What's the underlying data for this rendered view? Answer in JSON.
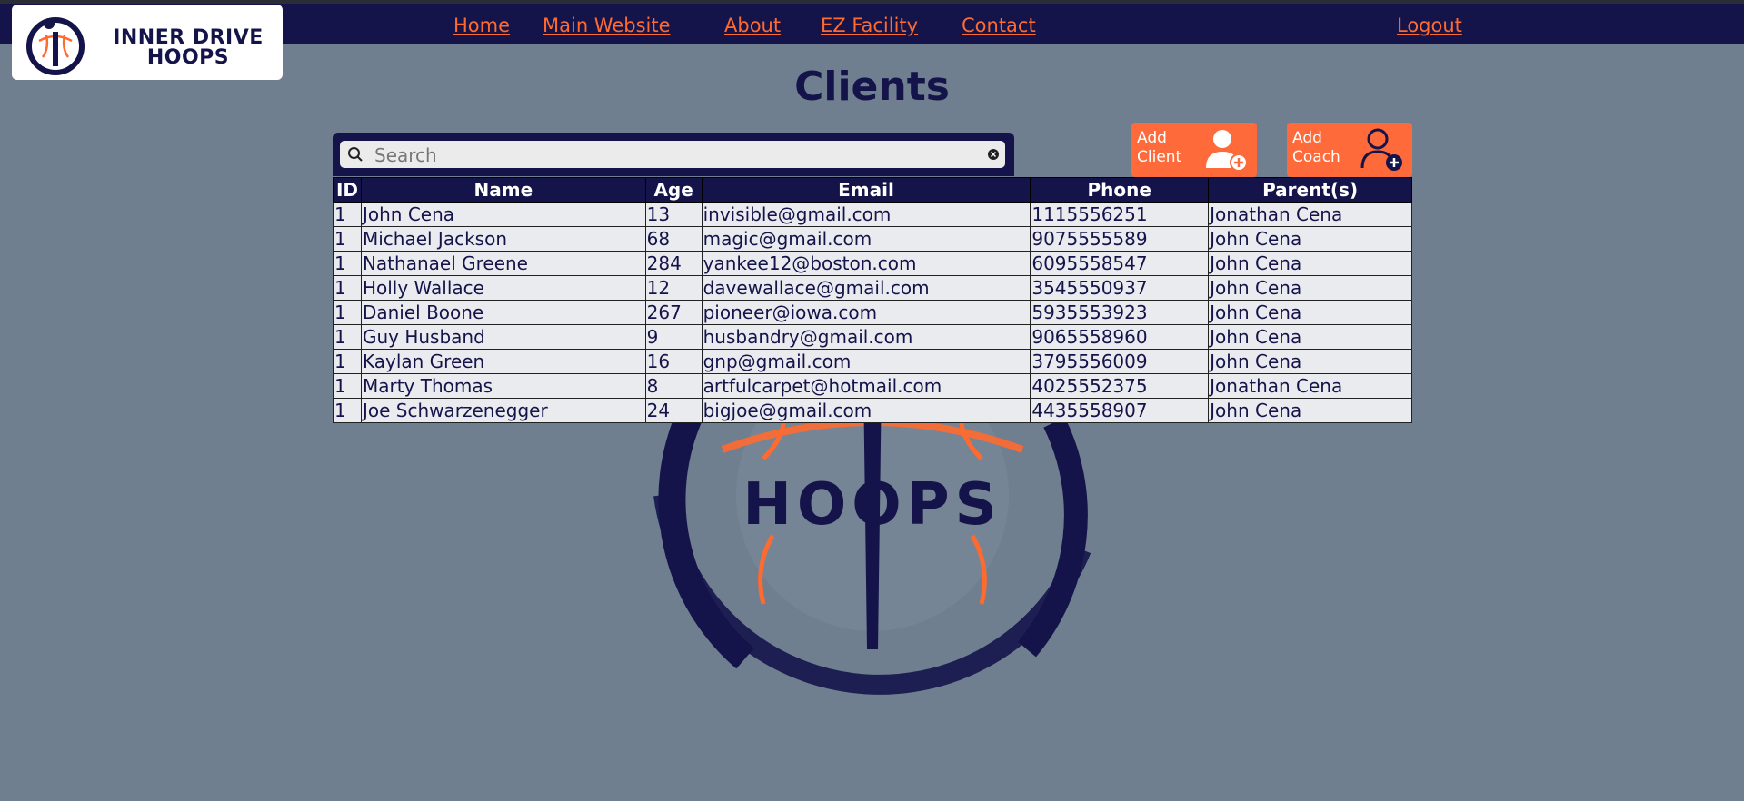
{
  "brand": {
    "line1": "INNER DRIVE",
    "line2": "HOOPS"
  },
  "nav": {
    "home": "Home",
    "main_website": "Main Website",
    "about": "About",
    "ez_facility": "EZ Facility",
    "contact": "Contact",
    "logout": "Logout"
  },
  "page": {
    "title": "Clients"
  },
  "search": {
    "placeholder": "Search",
    "value": ""
  },
  "actions": {
    "add_client_line1": "Add",
    "add_client_line2": "Client",
    "add_coach_line1": "Add",
    "add_coach_line2": "Coach"
  },
  "watermark_text": "HOOPS",
  "table": {
    "headers": [
      "ID",
      "Name",
      "Age",
      "Email",
      "Phone",
      "Parent(s)"
    ],
    "rows": [
      [
        "1",
        "John Cena",
        "13",
        "invisible@gmail.com",
        "1115556251",
        "Jonathan Cena"
      ],
      [
        "1",
        "Michael Jackson",
        "68",
        "magic@gmail.com",
        "9075555589",
        "John Cena"
      ],
      [
        "1",
        "Nathanael Greene",
        "284",
        "yankee12@boston.com",
        "6095558547",
        "John Cena"
      ],
      [
        "1",
        "Holly Wallace",
        "12",
        "davewallace@gmail.com",
        "3545550937",
        "John Cena"
      ],
      [
        "1",
        "Daniel Boone",
        "267",
        "pioneer@iowa.com",
        "5935553923",
        "John Cena"
      ],
      [
        "1",
        "Guy Husband",
        "9",
        "husbandry@gmail.com",
        "9065558960",
        "John Cena"
      ],
      [
        "1",
        "Kaylan Green",
        "16",
        "gnp@gmail.com",
        "3795556009",
        "John Cena"
      ],
      [
        "1",
        "Marty Thomas",
        "8",
        "artfulcarpet@hotmail.com",
        "4025552375",
        "Jonathan Cena"
      ],
      [
        "1",
        "Joe Schwarzenegger",
        "24",
        "bigjoe@gmail.com",
        "4435558907",
        "John Cena"
      ]
    ]
  },
  "colors": {
    "navy": "#14144a",
    "orange": "#ff6a2f",
    "background": "#6f7f90",
    "row_bg": "#eaebef"
  },
  "icons": {
    "logo": "basketball-figure-logo",
    "search": "search-icon",
    "clear": "clear-icon",
    "add_client": "add-user-icon",
    "add_coach": "add-user-outline-icon"
  }
}
